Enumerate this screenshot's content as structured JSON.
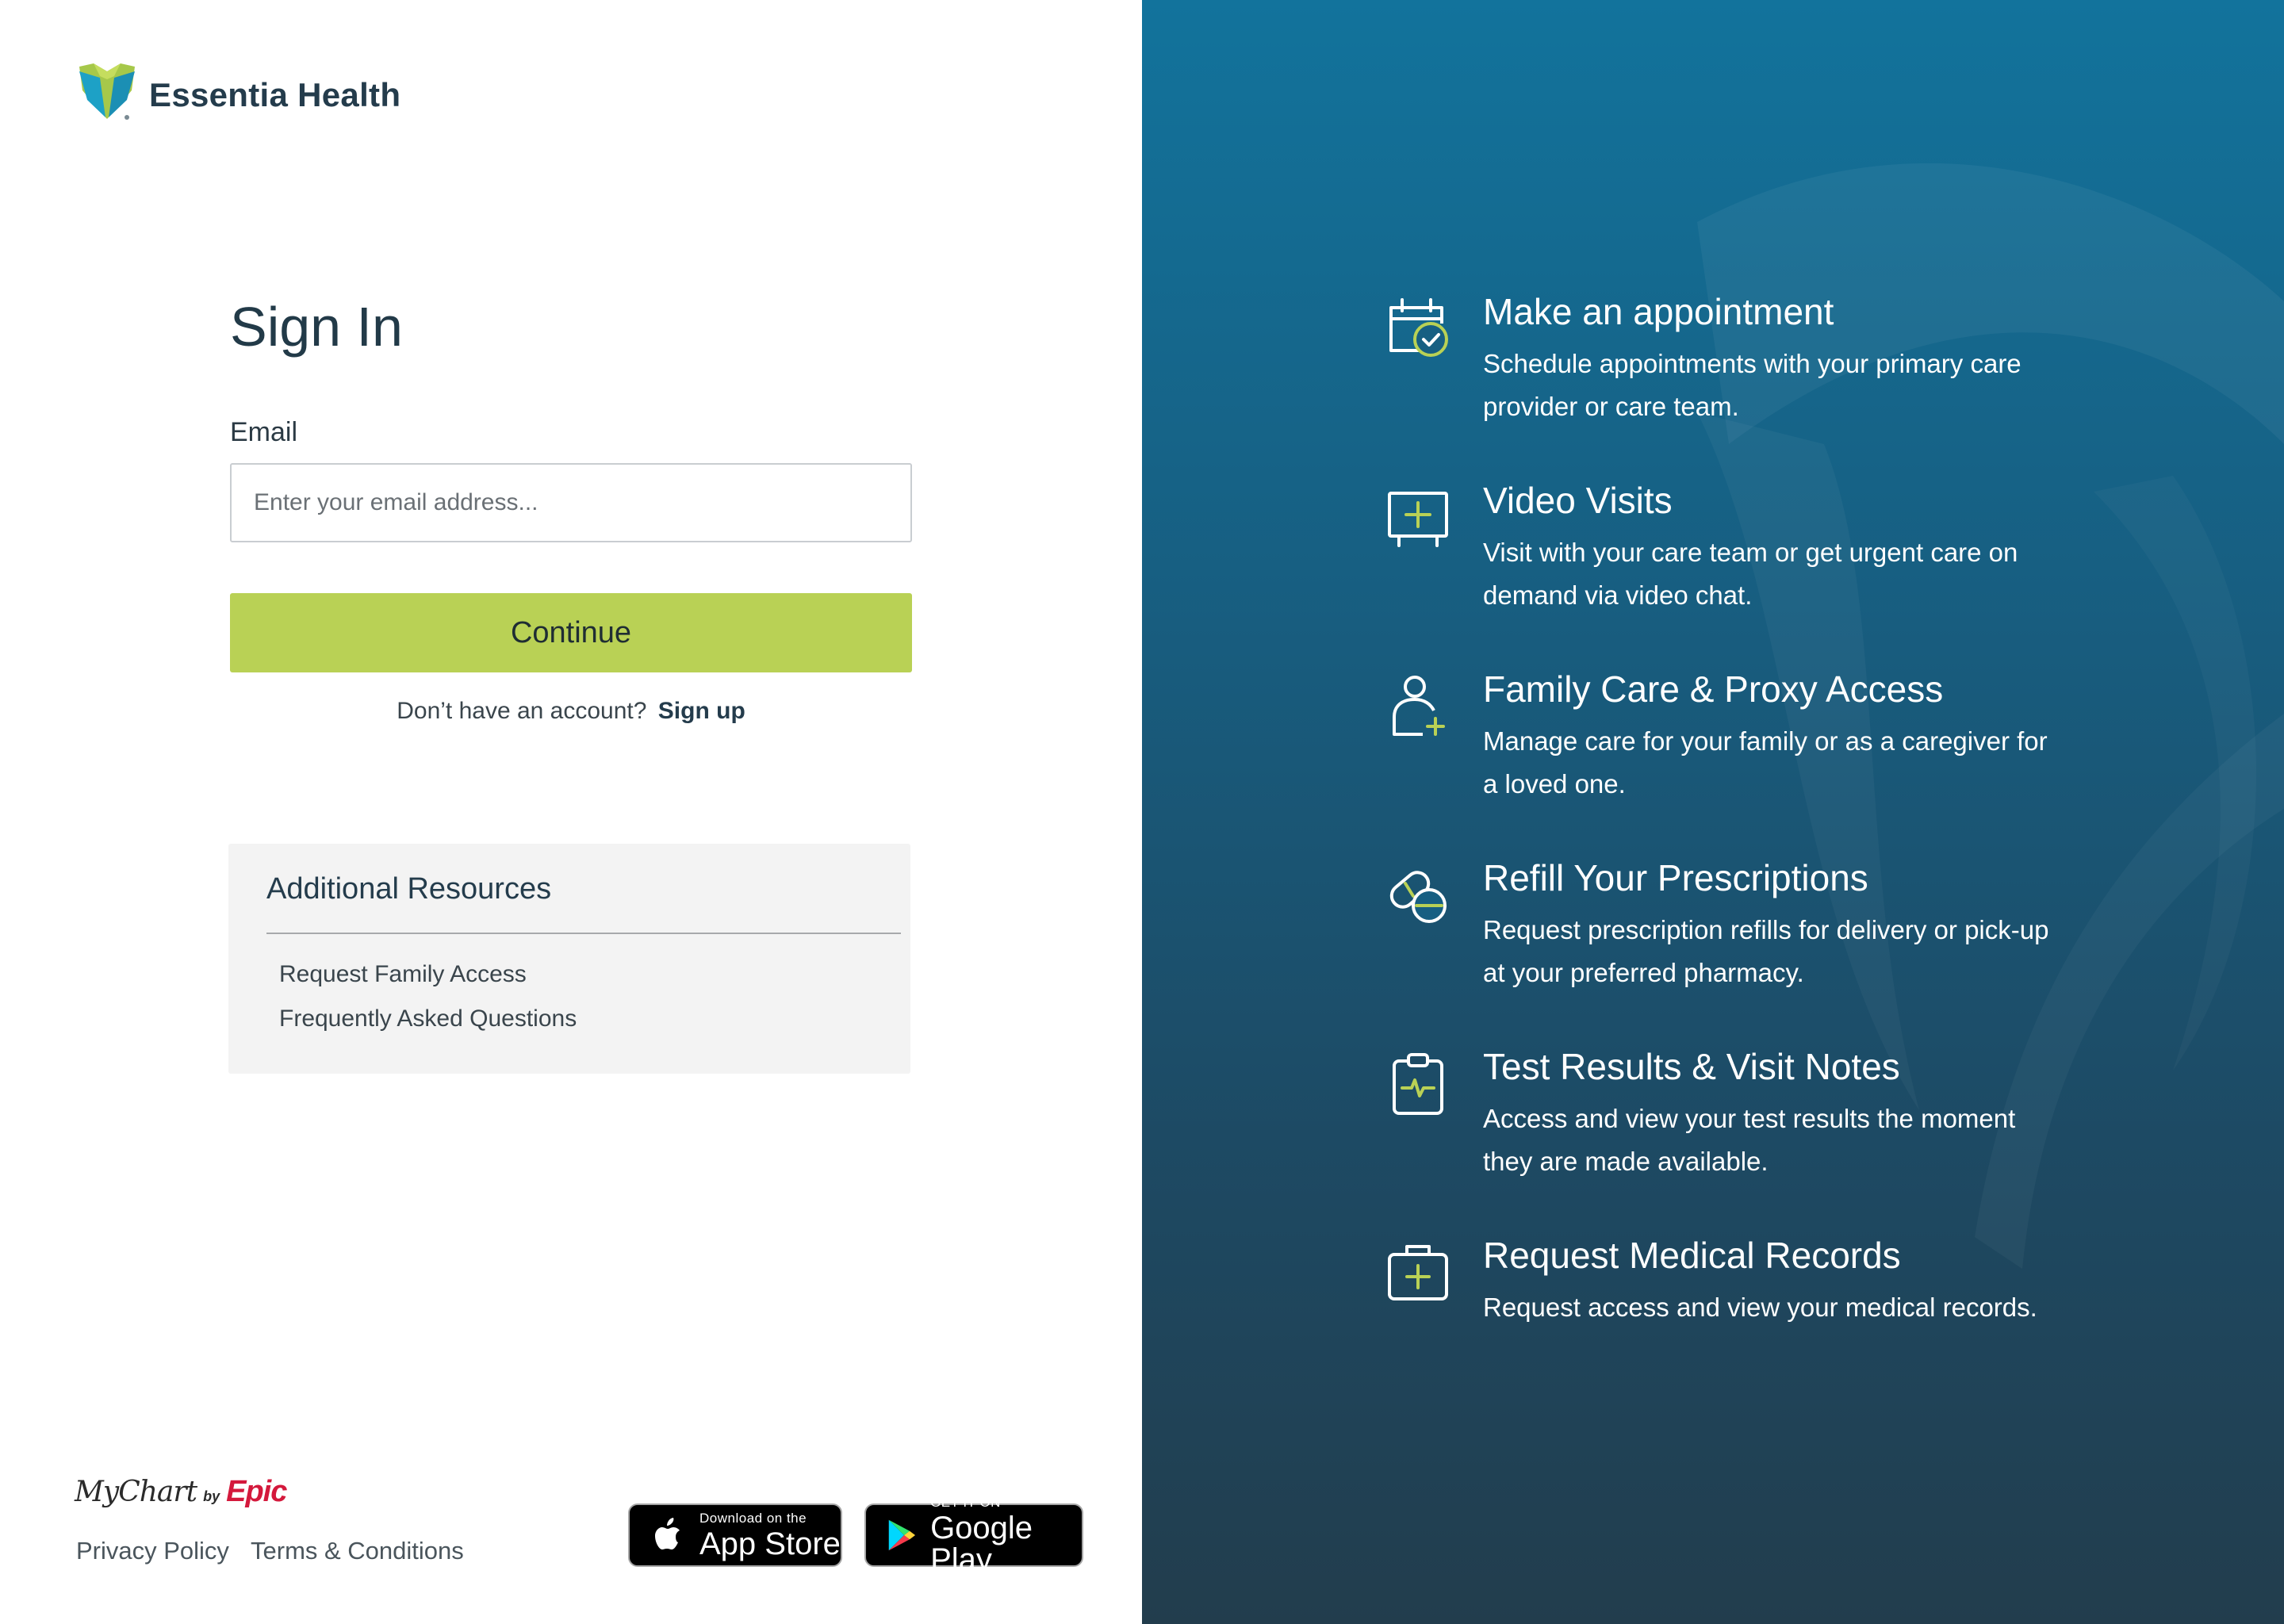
{
  "brand": {
    "name": "Essentia Health",
    "mychart": "MyChart",
    "by": "by",
    "epic": "Epic"
  },
  "signin": {
    "title": "Sign In",
    "email_label": "Email",
    "email_placeholder": "Enter your email address...",
    "email_value": "",
    "continue_label": "Continue",
    "no_account_text": "Don’t have an account?",
    "signup_label": "Sign up"
  },
  "resources": {
    "title": "Additional Resources",
    "links": [
      "Request Family Access",
      "Frequently Asked Questions"
    ]
  },
  "footer": {
    "privacy": "Privacy Policy",
    "terms": "Terms & Conditions",
    "app_store": {
      "small": "Download on the",
      "big": "App Store"
    },
    "google_play": {
      "small": "GET IT ON",
      "big": "Google Play"
    }
  },
  "features": [
    {
      "icon": "calendar-check-icon",
      "title": "Make an appointment",
      "desc": "Schedule appointments with your primary care provider or care team."
    },
    {
      "icon": "video-plus-icon",
      "title": "Video Visits",
      "desc": "Visit with your care team or get urgent care on demand via video chat."
    },
    {
      "icon": "person-plus-icon",
      "title": "Family Care & Proxy Access",
      "desc": "Manage care for your family or as a caregiver for a loved one."
    },
    {
      "icon": "pills-icon",
      "title": "Refill Your Prescriptions",
      "desc": "Request prescription refills for delivery or pick-up at your preferred pharmacy."
    },
    {
      "icon": "clipboard-pulse-icon",
      "title": "Test Results & Visit Notes",
      "desc": "Access and view your test results the moment they are made available."
    },
    {
      "icon": "medical-bag-icon",
      "title": "Request Medical Records",
      "desc": "Request access and view your medical records."
    }
  ],
  "colors": {
    "accent_green": "#b9d155",
    "brand_navy": "#243c4c",
    "panel_top": "#12739c",
    "panel_bottom": "#223d4d",
    "epic_red": "#d4193c"
  }
}
